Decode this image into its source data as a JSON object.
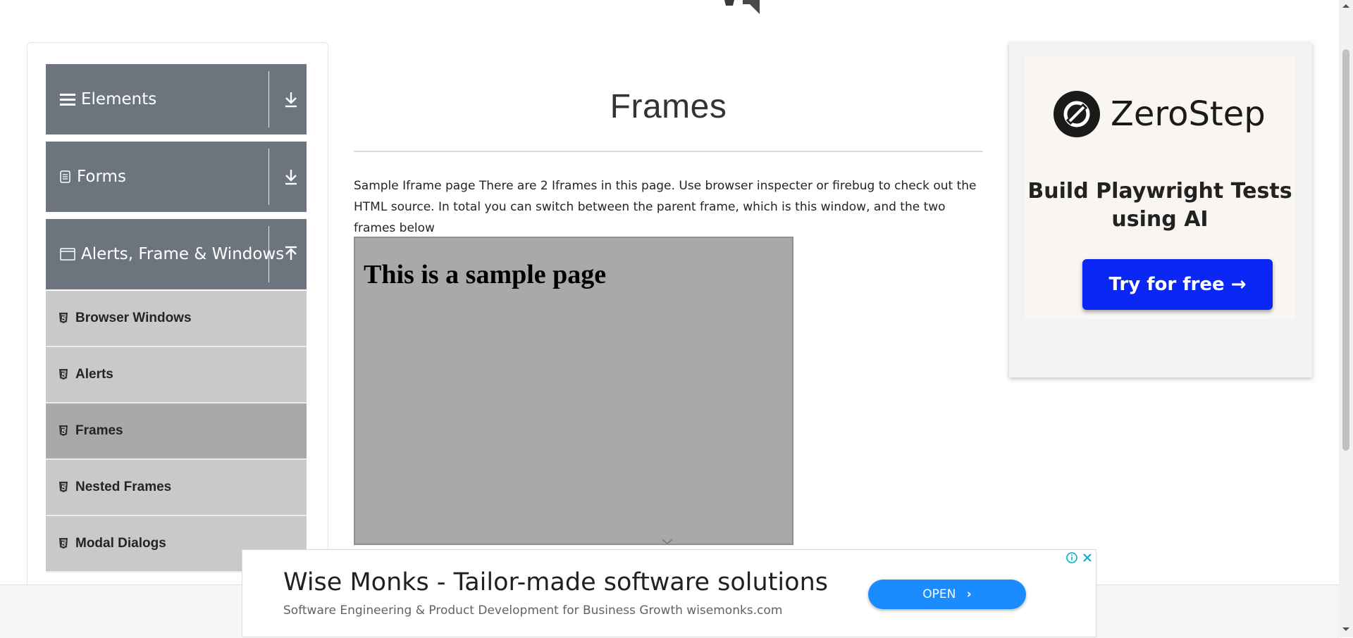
{
  "sidebar": {
    "groups": [
      {
        "label": "Elements",
        "icon": "hamburger-icon",
        "arrow": "download-arrow-icon"
      },
      {
        "label": "Forms",
        "icon": "document-icon",
        "arrow": "download-arrow-icon"
      },
      {
        "label": "Alerts, Frame & Windows",
        "icon": "window-icon",
        "arrow": "upload-arrow-icon"
      }
    ],
    "items": [
      {
        "label": "Browser Windows",
        "icon": "html5-icon"
      },
      {
        "label": "Alerts",
        "icon": "html5-icon"
      },
      {
        "label": "Frames",
        "icon": "html5-icon",
        "active": true
      },
      {
        "label": "Nested Frames",
        "icon": "html5-icon"
      },
      {
        "label": "Modal Dialogs",
        "icon": "html5-icon"
      }
    ]
  },
  "main": {
    "title": "Frames",
    "description": "Sample Iframe page There are 2 Iframes in this page. Use browser inspecter or firebug to check out the HTML source. In total you can switch between the parent frame, which is this window, and the two frames below",
    "iframe_heading": "This is a sample page"
  },
  "ad_right": {
    "brand": "ZeroStep",
    "tagline": "Build Playwright Tests using AI",
    "cta": "Try for free →",
    "colors": {
      "button": "#0a27f5",
      "background": "#f9f5f1"
    }
  },
  "banner": {
    "headline": "Wise Monks - Tailor-made software solutions",
    "subtext": "Software Engineering & Product Development for Business Growth wisemonks.com",
    "button": "OPEN",
    "colors": {
      "button": "#1a8cff"
    }
  },
  "colors": {
    "sidebar_header": "#6c757d",
    "menu_item": "#c9c9c9",
    "menu_item_active": "#a9a9a9",
    "iframe_bg": "#a9a9a9"
  }
}
